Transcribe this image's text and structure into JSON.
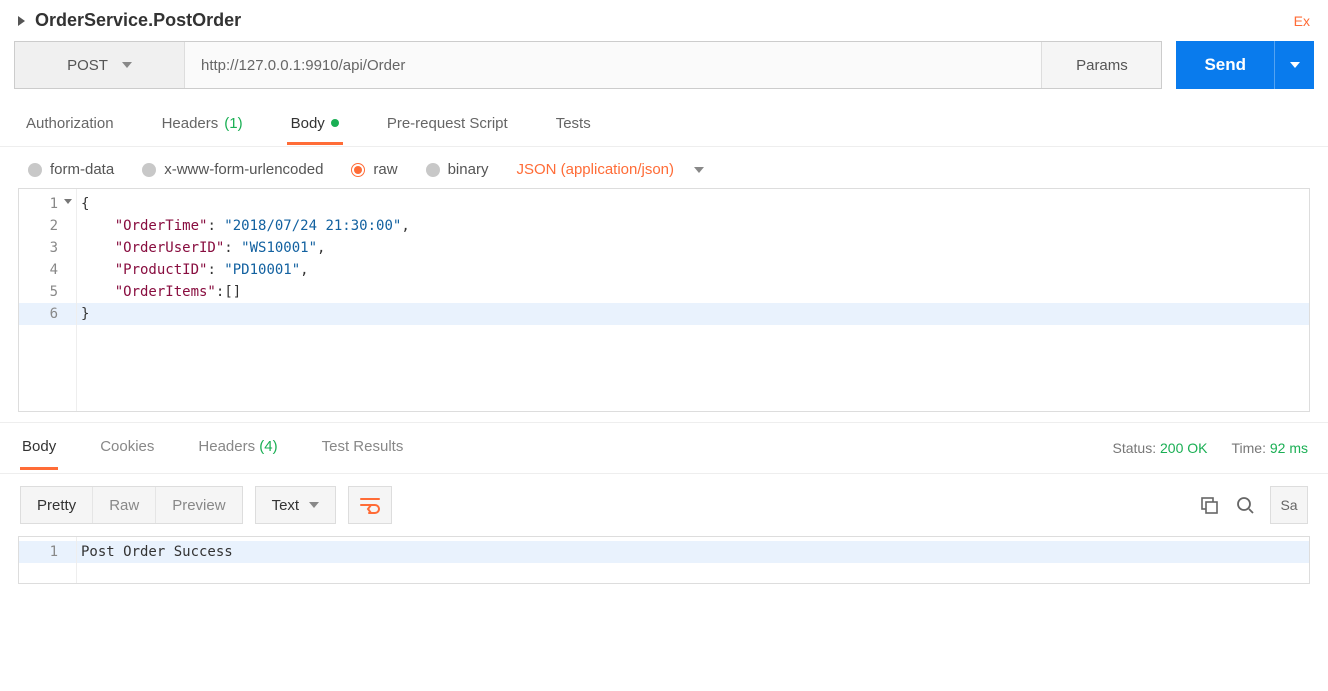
{
  "title": "OrderService.PostOrder",
  "top_right_text": "Ex",
  "method": "POST",
  "url": "http://127.0.0.1:9910/api/Order",
  "params_label": "Params",
  "send_label": "Send",
  "tabs": {
    "authorization": "Authorization",
    "headers": "Headers",
    "headers_count": "(1)",
    "body": "Body",
    "pre_request": "Pre-request Script",
    "tests": "Tests"
  },
  "body_types": {
    "form_data": "form-data",
    "urlencoded": "x-www-form-urlencoded",
    "raw": "raw",
    "binary": "binary"
  },
  "content_type": "JSON (application/json)",
  "request_body_lines": [
    "1",
    "2",
    "3",
    "4",
    "5",
    "6"
  ],
  "request_body": {
    "OrderTime": "2018/07/24 21:30:00",
    "OrderUserID": "WS10001",
    "ProductID": "PD10001",
    "OrderItems": []
  },
  "code": {
    "l1": "{",
    "l2_key": "\"OrderTime\"",
    "l2_val": "\"2018/07/24 21:30:00\"",
    "l3_key": "\"OrderUserID\"",
    "l3_val": "\"WS10001\"",
    "l4_key": "\"ProductID\"",
    "l4_val": "\"PD10001\"",
    "l5_key": "\"OrderItems\"",
    "l5_val": "[]",
    "l6": "}"
  },
  "response_tabs": {
    "body": "Body",
    "cookies": "Cookies",
    "headers": "Headers",
    "headers_count": "(4)",
    "test_results": "Test Results"
  },
  "status_label": "Status:",
  "status_value": "200 OK",
  "time_label": "Time:",
  "time_value": "92 ms",
  "view_modes": {
    "pretty": "Pretty",
    "raw": "Raw",
    "preview": "Preview"
  },
  "text_mode": "Text",
  "save_label": "Sa",
  "response_line_no": "1",
  "response_body": "Post Order Success"
}
